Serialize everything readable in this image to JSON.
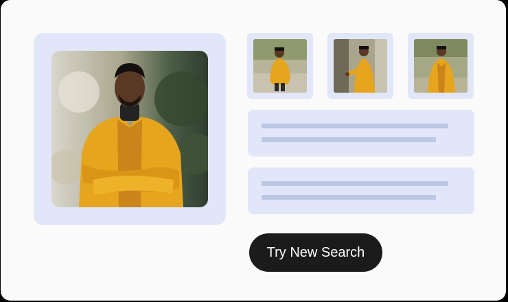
{
  "search_button": {
    "label": "Try New Search"
  },
  "main_image": {
    "icon": "person-photo-icon"
  },
  "thumbnails": [
    {
      "icon": "person-photo-icon"
    },
    {
      "icon": "person-photo-icon"
    },
    {
      "icon": "person-photo-icon"
    }
  ],
  "result_placeholders": [
    {
      "lines": 2
    },
    {
      "lines": 2
    }
  ],
  "colors": {
    "card_bg": "#fafafa",
    "panel_bg": "#e1e7f8",
    "line": "#bcc7e3",
    "button_bg": "#1b1b1b",
    "jacket": "#e6a51e"
  }
}
